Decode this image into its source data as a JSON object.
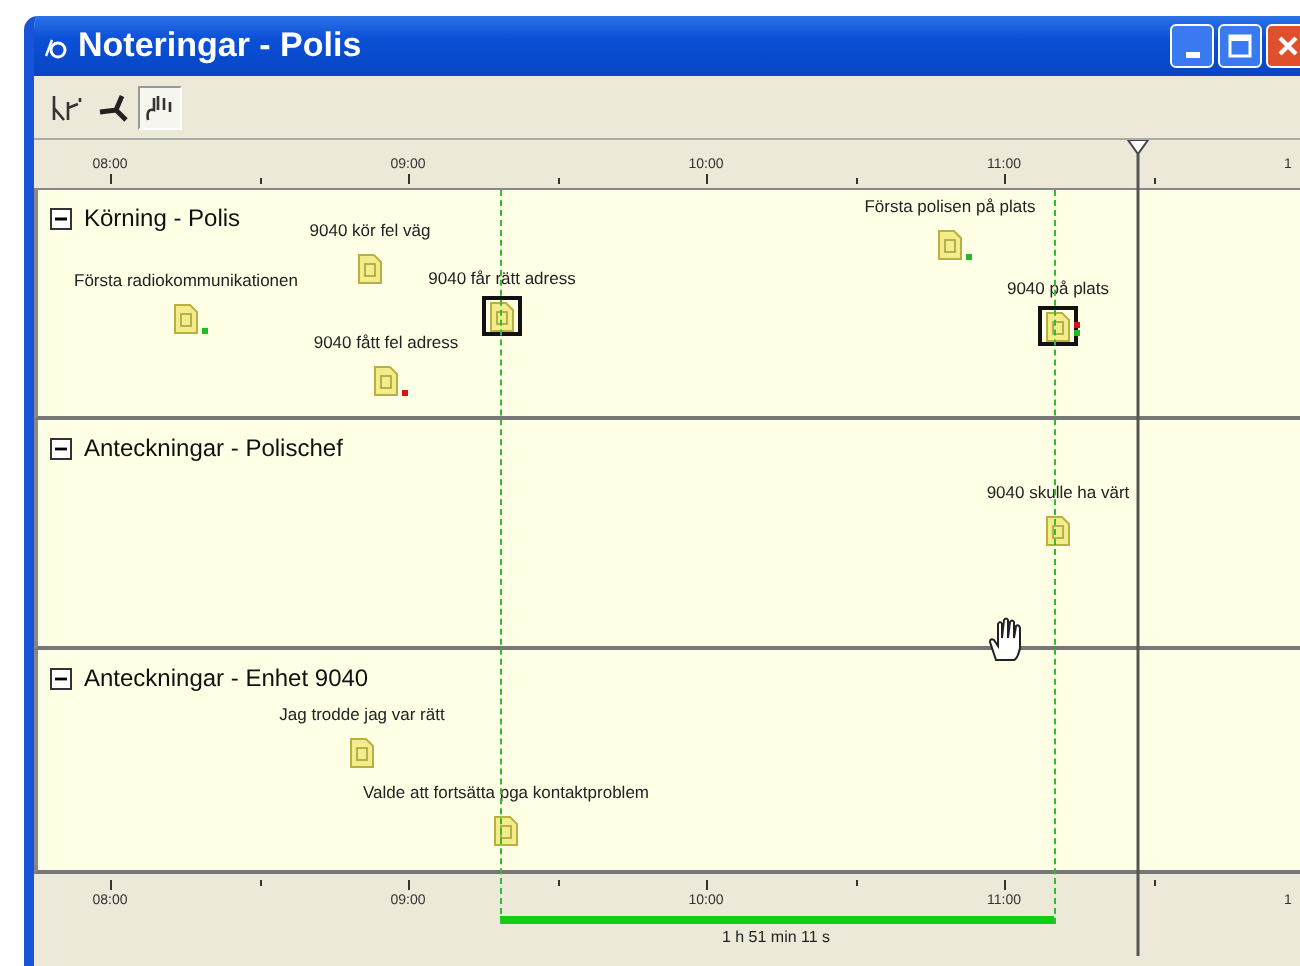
{
  "window": {
    "title": "Noteringar - Polis"
  },
  "toolbar": [
    {
      "selected": false
    },
    {
      "selected": false
    },
    {
      "selected": true
    }
  ],
  "top_ruler": {
    "labels": [
      "08:00",
      "09:00",
      "10:00",
      "11:00",
      "1"
    ]
  },
  "lanes": [
    {
      "title": "Körning - Polis",
      "expanded": true,
      "notes": [
        {
          "label": "Första radiokommunikationen",
          "selected": false,
          "markers": [
            {
              "color": "#22bb22"
            }
          ]
        },
        {
          "label": "9040 kör fel väg",
          "selected": false
        },
        {
          "label": "9040 får rätt adress",
          "selected": true
        },
        {
          "label": "9040 fått fel adress",
          "selected": false,
          "markers": [
            {
              "color": "#dd1111"
            }
          ]
        },
        {
          "label": "Första polisen på plats",
          "selected": false,
          "markers": [
            {
              "color": "#22bb22"
            }
          ]
        },
        {
          "label": "9040 på plats",
          "selected": true,
          "markers": [
            {
              "color": "#dd1111"
            },
            {
              "color": "#22bb22"
            }
          ]
        }
      ]
    },
    {
      "title": "Anteckningar - Polischef",
      "expanded": true,
      "notes": [
        {
          "label": "9040 skulle ha värt",
          "selected": false
        }
      ]
    },
    {
      "title": "Anteckningar - Enhet 9040",
      "expanded": true,
      "notes": [
        {
          "label": "Jag trodde jag var rätt",
          "selected": false
        },
        {
          "label": "Valde att fortsätta pga kontaktproblem",
          "selected": false
        }
      ]
    }
  ],
  "bottom_ruler": {
    "labels": [
      "08:00",
      "09:00",
      "10:00",
      "11:00",
      "1"
    ],
    "duration": "1 h 51 min 11 s"
  }
}
